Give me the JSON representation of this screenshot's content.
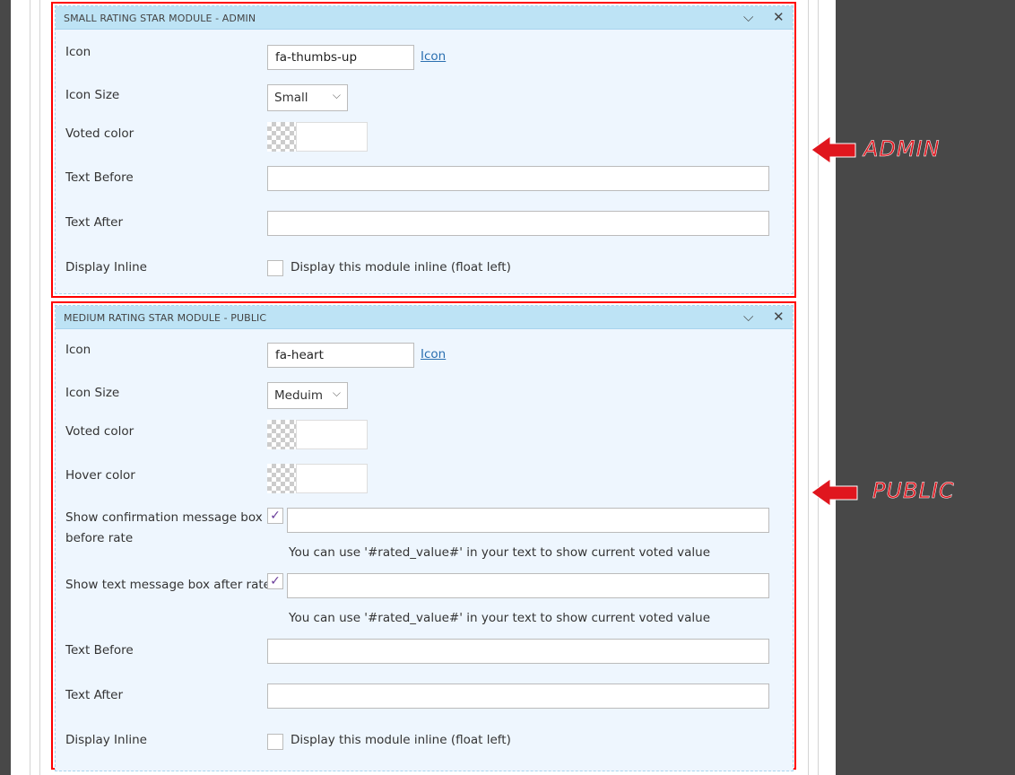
{
  "admin_panel": {
    "title": "SMALL RATING STAR MODULE - ADMIN",
    "icon_label": "Icon",
    "icon_value": "fa-thumbs-up",
    "icon_link": "Icon",
    "icon_size_label": "Icon Size",
    "icon_size_value": "Small",
    "voted_color_label": "Voted color",
    "text_before_label": "Text Before",
    "text_before_value": "",
    "text_after_label": "Text After",
    "text_after_value": "",
    "display_inline_label": "Display Inline",
    "display_inline_checkbox_label": "Display this module inline (float left)",
    "display_inline_checked": false
  },
  "public_panel": {
    "title": "MEDIUM RATING STAR MODULE - PUBLIC",
    "icon_label": "Icon",
    "icon_value": "fa-heart",
    "icon_link": "Icon",
    "icon_size_label": "Icon Size",
    "icon_size_value": "Meduim",
    "voted_color_label": "Voted color",
    "hover_color_label": "Hover color",
    "confirm_label_1": "Show confirmation message box",
    "confirm_label_2": "before rate",
    "confirm_checked": true,
    "confirm_value": "",
    "confirm_hint": "You can use '#rated_value#' in your text to show current voted value",
    "after_rate_label": "Show text message box after rate",
    "after_rate_checked": true,
    "after_rate_value": "",
    "after_rate_hint": "You can use '#rated_value#' in your text to show current voted value",
    "text_before_label": "Text Before",
    "text_after_label": "Text After",
    "display_inline_label": "Display Inline",
    "display_inline_checkbox_label": "Display this module inline (float left)",
    "display_inline_checked": false
  },
  "annotations": {
    "admin": "ADMIN",
    "public": "PUBLIC"
  },
  "icons": {
    "collapse": "chevron-down-icon",
    "close": "close-icon",
    "check": "✓",
    "chevron": "⌵"
  },
  "colors": {
    "annotation_red": "#e0161e",
    "panel_header": "#bde3f5",
    "panel_body": "#eef6fe"
  }
}
